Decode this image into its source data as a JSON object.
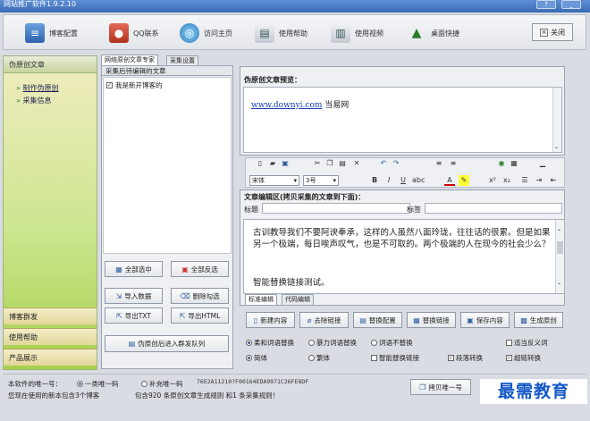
{
  "window": {
    "title": "网站推广软件1.9.2.10",
    "help_btn": "?",
    "min_btn": "_"
  },
  "toolbar": {
    "blog_config": "博客配置",
    "qq_contact": "QQ联系",
    "visit_home": "访问主页",
    "help": "使用帮助",
    "video": "使用视频",
    "shortcut": "桌面快捷",
    "close": "关闭"
  },
  "sidebar": {
    "header": "伪原创文章",
    "items": [
      "制作伪原创",
      "采集信息"
    ],
    "bottom": [
      "博客群发",
      "使用帮助",
      "产品展示"
    ]
  },
  "tabs": [
    "网络原创文章专家",
    "采集设置"
  ],
  "article_list": {
    "header": "采集后待编辑的文章",
    "items": [
      {
        "label": "我是新开博客的",
        "checked": true
      }
    ]
  },
  "list_buttons": {
    "select_all": "全部选中",
    "invert": "全部反选",
    "import": "导入数据",
    "delete_checked": "删除勾选",
    "export_txt": "导出TXT",
    "export_html": "导出HTML",
    "enqueue": "伪原创后进入群发队列"
  },
  "preview": {
    "header": "伪原创文章预览：",
    "link_text": "www.downyi.com",
    "site_name": " 当易网"
  },
  "editor": {
    "font_name": "宋体",
    "font_size": "3号",
    "area_label": "文章编辑区(拷贝采集的文章到下面)：",
    "title_label": "标题",
    "tags_label": "标签",
    "body_text": "古训教导我们不要阿谀奉承，这样的人虽然八面玲珑，往往话的很累。但是如果另一个极端，每日唉声叹气，也是不可取的。两个极端的人在现今的社会少么？",
    "body_text2": "智能替换链接测试。",
    "mode_tabs": [
      "标准编辑",
      "代码编辑"
    ]
  },
  "actions": {
    "new_content": "新建内容",
    "remove_links": "去除链接",
    "replace_config": "替换配置",
    "replace_links": "替换链接",
    "save_content": "保存内容",
    "generate": "生成原创"
  },
  "options": {
    "row1": [
      {
        "label": "柔和词语替换",
        "selected": true
      },
      {
        "label": "暴力词语替换",
        "selected": false
      },
      {
        "label": "词语不替换",
        "selected": false
      }
    ],
    "reverse_sense": {
      "label": "适当反义词",
      "checked": false
    },
    "row2": [
      {
        "label": "简体",
        "selected": true
      },
      {
        "label": "繁体",
        "selected": false
      }
    ],
    "smart_link": {
      "label": "智能替换链接",
      "checked": false
    },
    "paragraph": {
      "label": "段落转换",
      "checked": true
    },
    "hyperlink": {
      "label": "超链转换",
      "checked": true
    }
  },
  "status": {
    "unique_label": "本软件的唯一号：",
    "opt_primary": "一类唯一码",
    "opt_secondary": "补充唯一码",
    "code": "76E2A11210?F00164EDA9971C26FE8DF",
    "version_line": "您现在使用的新本包含3个博客",
    "stats_line": "包含920 条原创文章生成规则 和1 条采集规则！",
    "copy_btn": "拷贝唯一号"
  },
  "watermark": "最需教育",
  "colors": {
    "accent": "#3a6cb4",
    "sidebar_green": "#a7d04a",
    "link": "#1a3fb8"
  }
}
